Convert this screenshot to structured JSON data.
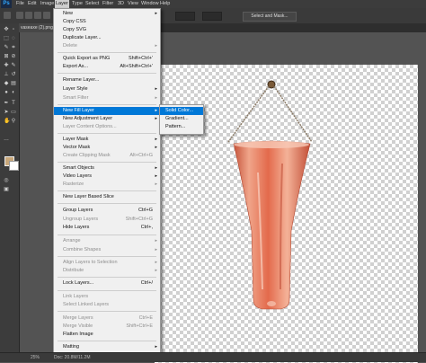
{
  "menubar": {
    "logo": "Ps",
    "items": [
      "File",
      "Edit",
      "Image",
      "Layer",
      "Type",
      "Select",
      "Filter",
      "3D",
      "View",
      "Window",
      "Help"
    ]
  },
  "options_bar": {
    "mode_label": "Mode:",
    "select_mask_label": "Select and Mask..."
  },
  "document_tab": {
    "label": "vaseaxe (2).png"
  },
  "layer_menu": {
    "items": [
      {
        "label": "New",
        "shortcut": "",
        "submenu": true,
        "disabled": false
      },
      {
        "label": "Copy CSS",
        "shortcut": "",
        "submenu": false,
        "disabled": false
      },
      {
        "label": "Copy SVG",
        "shortcut": "",
        "submenu": false,
        "disabled": false
      },
      {
        "label": "Duplicate Layer...",
        "shortcut": "",
        "submenu": false,
        "disabled": false
      },
      {
        "label": "Delete",
        "shortcut": "",
        "submenu": true,
        "disabled": true
      },
      {
        "label": "Quick Export as PNG",
        "shortcut": "Shift+Ctrl+'",
        "submenu": false,
        "disabled": false
      },
      {
        "label": "Export As...",
        "shortcut": "Alt+Shift+Ctrl+'",
        "submenu": false,
        "disabled": false
      },
      {
        "label": "Rename Layer...",
        "shortcut": "",
        "submenu": false,
        "disabled": false
      },
      {
        "label": "Layer Style",
        "shortcut": "",
        "submenu": true,
        "disabled": false
      },
      {
        "label": "Smart Filter",
        "shortcut": "",
        "submenu": true,
        "disabled": true
      },
      {
        "label": "New Fill Layer",
        "shortcut": "",
        "submenu": true,
        "disabled": false,
        "highlighted": true
      },
      {
        "label": "New Adjustment Layer",
        "shortcut": "",
        "submenu": true,
        "disabled": false
      },
      {
        "label": "Layer Content Options...",
        "shortcut": "",
        "submenu": false,
        "disabled": true
      },
      {
        "label": "Layer Mask",
        "shortcut": "",
        "submenu": true,
        "disabled": false
      },
      {
        "label": "Vector Mask",
        "shortcut": "",
        "submenu": true,
        "disabled": false
      },
      {
        "label": "Create Clipping Mask",
        "shortcut": "Alt+Ctrl+G",
        "submenu": false,
        "disabled": true
      },
      {
        "label": "Smart Objects",
        "shortcut": "",
        "submenu": true,
        "disabled": false
      },
      {
        "label": "Video Layers",
        "shortcut": "",
        "submenu": true,
        "disabled": false
      },
      {
        "label": "Rasterize",
        "shortcut": "",
        "submenu": true,
        "disabled": true
      },
      {
        "label": "New Layer Based Slice",
        "shortcut": "",
        "submenu": false,
        "disabled": false
      },
      {
        "label": "Group Layers",
        "shortcut": "Ctrl+G",
        "submenu": false,
        "disabled": false
      },
      {
        "label": "Ungroup Layers",
        "shortcut": "Shift+Ctrl+G",
        "submenu": false,
        "disabled": true
      },
      {
        "label": "Hide Layers",
        "shortcut": "Ctrl+,",
        "submenu": false,
        "disabled": false
      },
      {
        "label": "Arrange",
        "shortcut": "",
        "submenu": true,
        "disabled": true
      },
      {
        "label": "Combine Shapes",
        "shortcut": "",
        "submenu": true,
        "disabled": true
      },
      {
        "label": "Align Layers to Selection",
        "shortcut": "",
        "submenu": true,
        "disabled": true
      },
      {
        "label": "Distribute",
        "shortcut": "",
        "submenu": true,
        "disabled": true
      },
      {
        "label": "Lock Layers...",
        "shortcut": "Ctrl+/",
        "submenu": false,
        "disabled": false
      },
      {
        "label": "Link Layers",
        "shortcut": "",
        "submenu": false,
        "disabled": true
      },
      {
        "label": "Select Linked Layers",
        "shortcut": "",
        "submenu": false,
        "disabled": true
      },
      {
        "label": "Merge Layers",
        "shortcut": "Ctrl+E",
        "submenu": false,
        "disabled": true
      },
      {
        "label": "Merge Visible",
        "shortcut": "Shift+Ctrl+E",
        "submenu": false,
        "disabled": true
      },
      {
        "label": "Flatten Image",
        "shortcut": "",
        "submenu": false,
        "disabled": false
      },
      {
        "label": "Matting",
        "shortcut": "",
        "submenu": true,
        "disabled": false
      }
    ]
  },
  "fill_submenu": {
    "items": [
      {
        "label": "Solid Color...",
        "highlighted": true
      },
      {
        "label": "Gradient...",
        "highlighted": false
      },
      {
        "label": "Pattern...",
        "highlighted": false
      }
    ]
  },
  "statusbar": {
    "zoom": "25%",
    "doc_info": "Doc: 20.8M/11.2M"
  },
  "colors": {
    "foreground": "#c8a77a",
    "background": "#ffffff",
    "highlight": "#0078d7",
    "vase": "#e87a5c"
  }
}
